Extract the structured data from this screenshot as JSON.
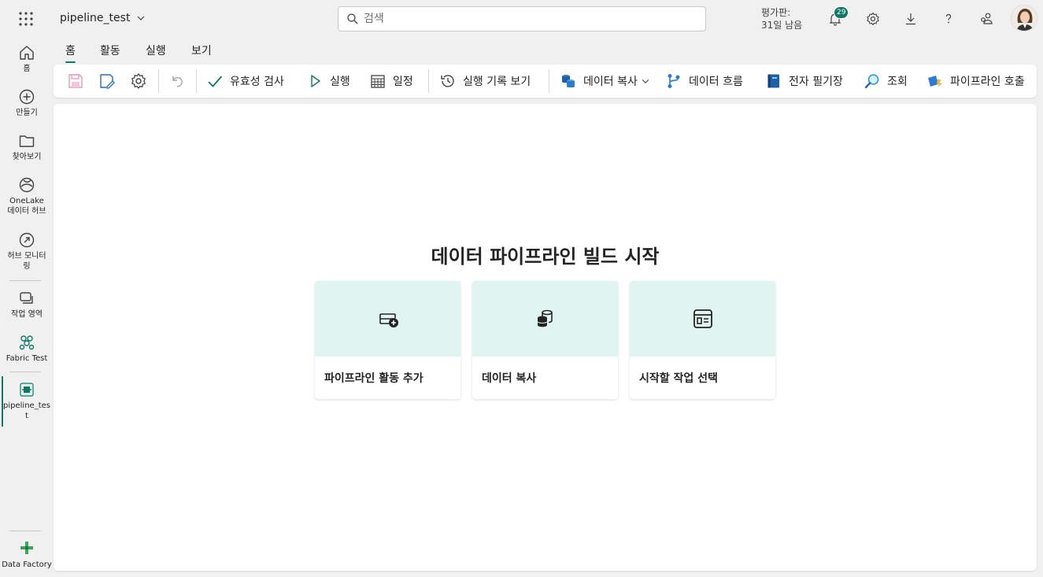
{
  "topbar": {
    "app_launcher_icon": "waffle-icon",
    "item_title": "pipeline_test",
    "search_placeholder": "검색",
    "trial_line1": "평가판:",
    "trial_line2": "31일 남음",
    "notification_count": "29",
    "icons": [
      "bell-icon",
      "gear-icon",
      "download-icon",
      "help-icon",
      "share-people-icon"
    ]
  },
  "leftnav": {
    "items": [
      {
        "label": "홈",
        "icon": "home-icon"
      },
      {
        "label": "만들기",
        "icon": "plus-circle-icon"
      },
      {
        "label": "찾아보기",
        "icon": "folder-icon"
      },
      {
        "label": "OneLake 데이터 허브",
        "icon": "onelake-icon"
      },
      {
        "label": "허브 모니터링",
        "icon": "monitor-icon"
      },
      {
        "label": "작업 영역",
        "icon": "workspaces-icon"
      },
      {
        "label": "Fabric Test",
        "icon": "fabric-workspace-icon"
      },
      {
        "label": "pipeline_test",
        "icon": "pipeline-icon"
      }
    ],
    "footer_label": "Data Factory"
  },
  "tabs": [
    "홈",
    "활동",
    "실행",
    "보기"
  ],
  "active_tab": "홈",
  "toolbar": {
    "validate": "유효성 검사",
    "run": "실행",
    "schedule": "일정",
    "run_history": "실행 기록 보기",
    "copy_data": "데이터 복사",
    "dataflow": "데이터 흐름",
    "notebook": "전자 필기장",
    "lookup": "조회",
    "invoke_pipeline": "파이프라인 호출"
  },
  "canvas": {
    "title": "데이터 파이프라인 빌드 시작",
    "cards": [
      {
        "label": "파이프라인 활동 추가",
        "icon": "pipeline-add-icon"
      },
      {
        "label": "데이터 복사",
        "icon": "copy-data-icon"
      },
      {
        "label": "시작할 작업 선택",
        "icon": "template-icon"
      }
    ]
  },
  "colors": {
    "accent": "#117865",
    "card_header": "#e0f5ef",
    "background": "#f0f0f0"
  }
}
